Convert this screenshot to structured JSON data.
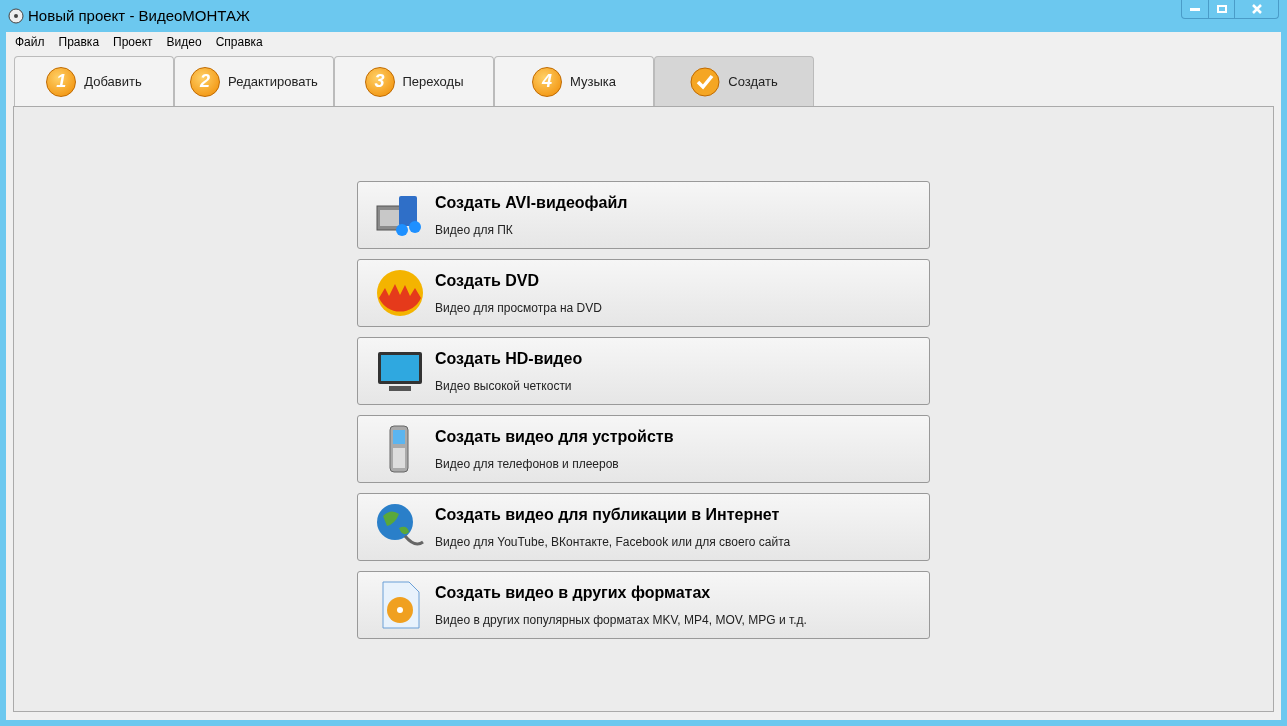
{
  "window": {
    "title": "Новый проект - ВидеоМОНТАЖ"
  },
  "menu": [
    "Файл",
    "Правка",
    "Проект",
    "Видео",
    "Справка"
  ],
  "tabs": [
    {
      "label": "Добавить",
      "badge": "1",
      "kind": "number",
      "selected": false
    },
    {
      "label": "Редактировать",
      "badge": "2",
      "kind": "number",
      "selected": false
    },
    {
      "label": "Переходы",
      "badge": "3",
      "kind": "number",
      "selected": false
    },
    {
      "label": "Музыка",
      "badge": "4",
      "kind": "number",
      "selected": false
    },
    {
      "label": "Создать",
      "kind": "check",
      "selected": true
    }
  ],
  "options": [
    {
      "kind": "film",
      "title": "Создать AVI-видеофайл",
      "subtitle": "Видео для ПК"
    },
    {
      "kind": "dvd",
      "title": "Создать DVD",
      "subtitle": "Видео для просмотра на DVD"
    },
    {
      "kind": "tv",
      "title": "Создать HD-видео",
      "subtitle": "Видео высокой четкости"
    },
    {
      "kind": "phone",
      "title": "Создать видео для устройств",
      "subtitle": "Видео для телефонов и плееров"
    },
    {
      "kind": "globe",
      "title": "Создать видео для публикации в Интернет",
      "subtitle": "Видео для YouTube, ВКонтакте, Facebook или для своего сайта"
    },
    {
      "kind": "file",
      "title": "Создать видео в других форматах",
      "subtitle": "Видео в других популярных форматах MKV, MP4, MOV, MPG и т.д."
    }
  ]
}
